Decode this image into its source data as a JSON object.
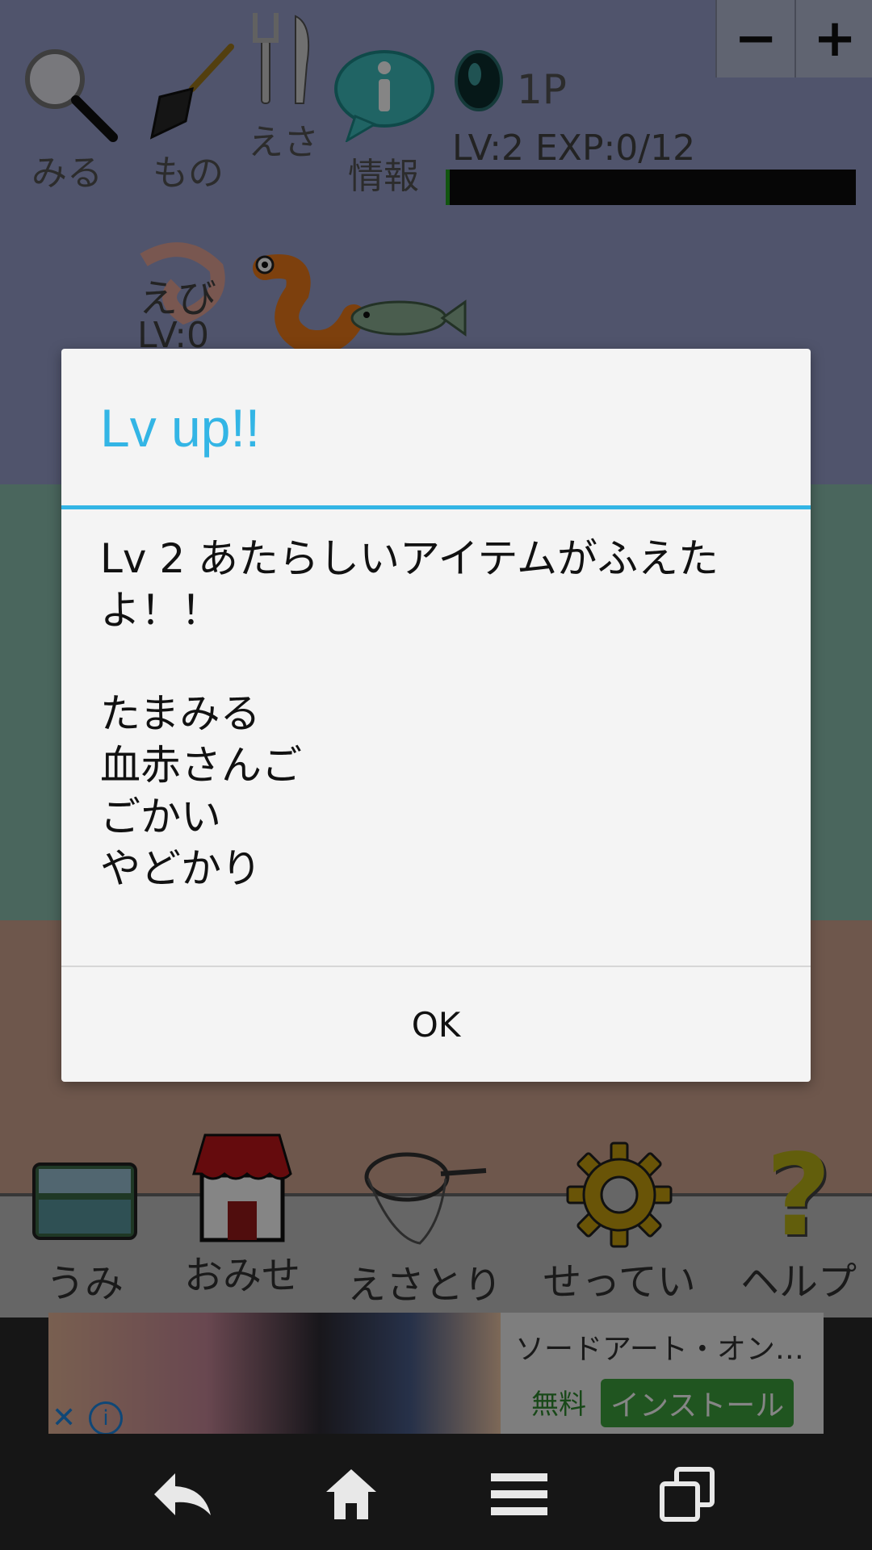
{
  "toolbar": {
    "look_label": "みる",
    "items_label": "もの",
    "bait_label": "えさ",
    "info_label": "情報",
    "zoom_out": "−",
    "zoom_in": "+"
  },
  "player": {
    "pages": "1P",
    "level_text": "LV:2 EXP:0/12",
    "exp_fraction": 0.01
  },
  "creature": {
    "name": "えび",
    "level": "LV:0"
  },
  "dialog": {
    "title": "Lv up!!",
    "message_line1": "Lv 2 あたらしいアイテムがふえたよ！！",
    "new_items": [
      "たまみる",
      "血赤さんご",
      "ごかい",
      "やどかり"
    ],
    "ok_label": "OK",
    "accent_color": "#33b5e5"
  },
  "bottom_nav": {
    "sea_label": "うみ",
    "shop_label": "おみせ",
    "catch_label": "えさとり",
    "settings_label": "せってい",
    "help_label": "ヘルプ"
  },
  "ad": {
    "title": "ソードアート・オン…",
    "price": "無料",
    "install_label": "インストール",
    "close_label": "✕",
    "info_label": "i"
  },
  "system_nav": {
    "back": "back-icon",
    "home": "home-icon",
    "menu": "menu-icon",
    "recents": "recents-icon"
  }
}
